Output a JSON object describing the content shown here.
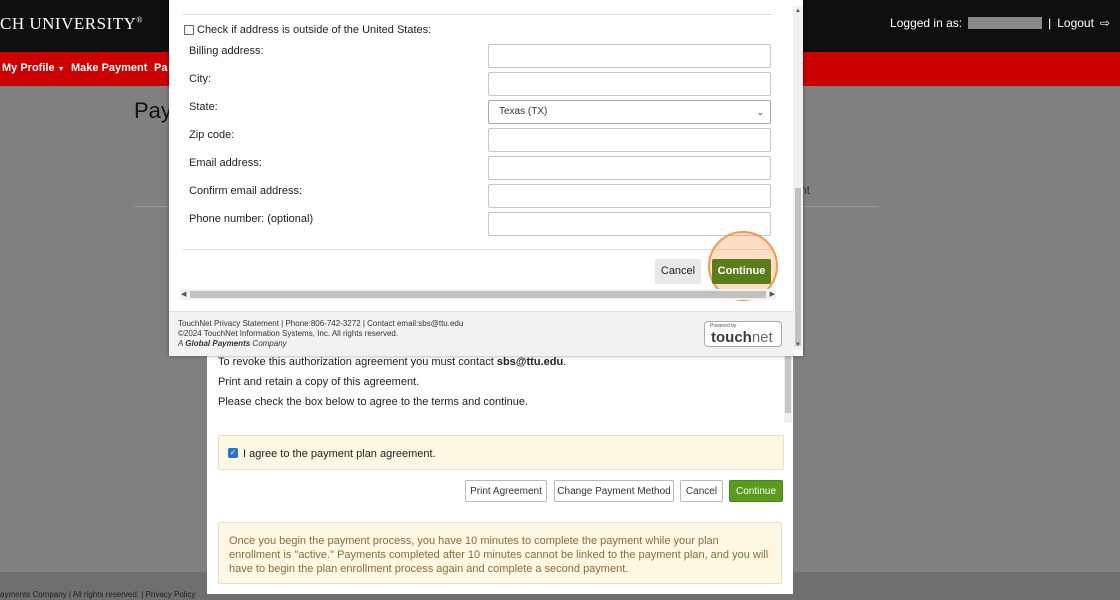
{
  "header": {
    "university": "CH UNIVERSITY",
    "logged_in_label": "Logged in as:",
    "logout_label": "Logout"
  },
  "nav": {
    "items": [
      "My Profile",
      "Make Payment",
      "Pa"
    ]
  },
  "page": {
    "title": "Pay",
    "ghost_tab": "nt"
  },
  "agreement_panel": {
    "revoke_prefix": "To revoke this authorization agreement you must contact ",
    "revoke_email": "sbs@ttu.edu",
    "revoke_suffix": ".",
    "print_text": "Print and retain a copy of this agreement.",
    "check_text": "Please check the box below to agree to the terms and continue.",
    "agree_label": "I agree to the payment plan agreement.",
    "agree_checked": true,
    "buttons": {
      "print": "Print Agreement",
      "change": "Change Payment Method",
      "cancel": "Cancel",
      "continue": "Continue"
    },
    "note": "Once you begin the payment process, you have 10 minutes to complete the payment while your plan enrollment is \"active.\" Payments completed after 10 minutes cannot be linked to the payment plan, and you will have to begin the plan enrollment process again and complete a second payment."
  },
  "modal": {
    "outside_us_label": "Check if address is outside of the United States:",
    "fields": {
      "billing": "Billing address:",
      "city": "City:",
      "state": "State:",
      "zip": "Zip code:",
      "email": "Email address:",
      "confirm_email": "Confirm email address:",
      "phone": "Phone number: (optional)"
    },
    "state_value": "Texas (TX)",
    "cancel_label": "Cancel",
    "continue_label": "Continue",
    "footer": {
      "line1": "TouchNet Privacy Statement  | Phone:806-742-3272 | Contact email:sbs@ttu.edu",
      "line2": "©2024 TouchNet Information Systems, Inc. All rights reserved.",
      "line3_prefix": "A ",
      "line3_bold": "Global Payments",
      "line3_suffix": " Company",
      "powered_by": "Powered by",
      "brand_a": "touch",
      "brand_b": "net"
    }
  },
  "page_footer": {
    "text": "ayments Company | All rights reserved. |  Privacy Policy"
  },
  "colors": {
    "red_bar": "#cc0000",
    "continue_green": "#5a9b1e",
    "modal_continue": "#5a7d1a",
    "highlight_ring": "#f28d40"
  }
}
